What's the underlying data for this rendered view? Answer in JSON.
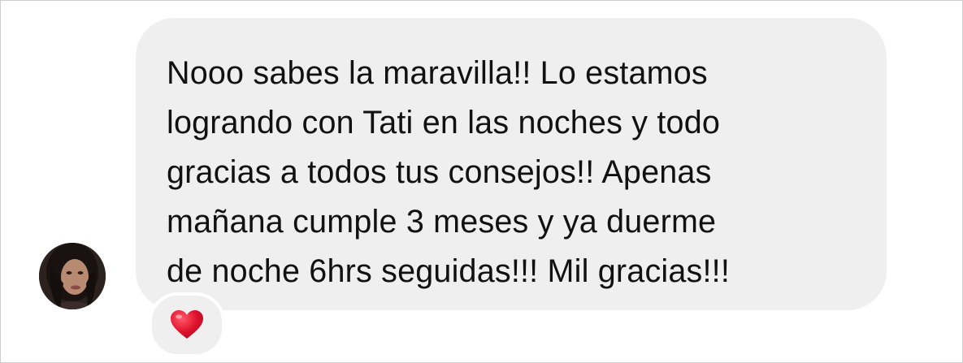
{
  "message": {
    "lines": [
      "Nooo sabes la maravilla!! Lo estamos",
      "logrando con Tati en las noches y todo",
      "gracias a todos tus consejos!! Apenas",
      "mañana cumple 3 meses y ya duerme",
      "de noche 6hrs seguidas!!! Mil gracias!!!"
    ]
  },
  "reaction": {
    "icon": "heart-icon",
    "color": "#e0122d"
  },
  "colors": {
    "bubble": "#efefef",
    "text": "#111111"
  }
}
